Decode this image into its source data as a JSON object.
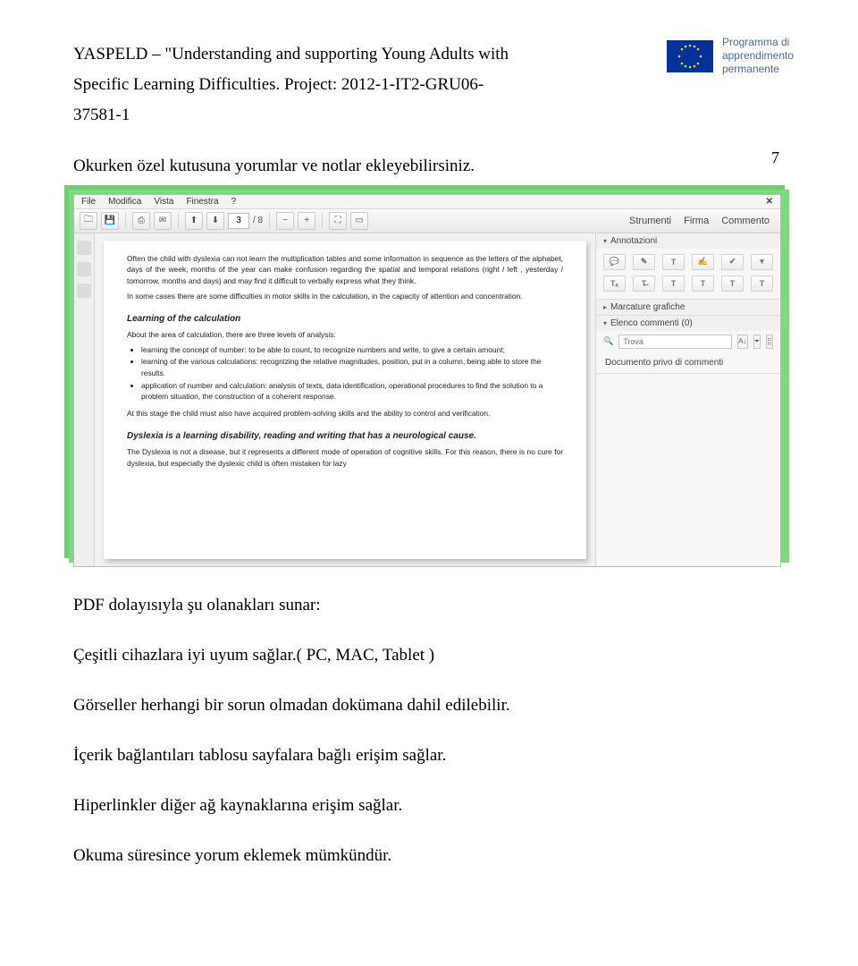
{
  "header": {
    "line1_prefix": "YASPELD – ",
    "line1_quote": "\"Understanding and supporting Young Adults with",
    "line2_quote": "Specific Learning Difficulties.",
    "line2_project": " Project: 2012-1-IT2-GRU06-",
    "line3": "37581-1"
  },
  "logo": {
    "stars": "⁕",
    "programma_line1": "Programma di",
    "programma_line2": "apprendimento",
    "programma_line3": "permanente"
  },
  "page_number": "7",
  "intro_para": "Okurken özel kutusuna yorumlar ve notlar ekleyebilirsiniz.",
  "reader": {
    "menu": {
      "file": "File",
      "modifica": "Modifica",
      "vista": "Vista",
      "finestra": "Finestra",
      "help": "?"
    },
    "toolbar": {
      "page_current": "3",
      "page_total": "/ 8",
      "right": {
        "strumenti": "Strumenti",
        "firma": "Firma",
        "commento": "Commento"
      }
    },
    "doc": {
      "p1": "Often the child with dyslexia can not learn the multiplication tables and some information in sequence as the letters of the alphabet, days of the week, months of the year can make confusion regarding the spatial and temporal relations (right / left , yesterday / tomorrow, months and days) and may find it difficult to verbally express what they think.",
      "p2": "In some cases there are some difficulties in motor skills in the calculation, in the capacity of attention and concentration.",
      "h1": "Learning of the calculation",
      "p3": "About the area of calculation, there are three levels of analysis:",
      "b1": "learning the concept of number: to be able to count, to recognize numbers and write, to give a certain amount;",
      "b2": "learning of the various calculations: recognizing the relative magnitudes, position, put in a column, being able to store the results.",
      "b3": "application of number and calculation: analysis of texts, data identification, operational procedures to find the solution to a problem situation, the construction of a coherent response.",
      "p4": "At this stage the child must also have acquired problem-solving skills and the ability to control and verification.",
      "h2": "Dyslexia is a learning disability, reading and writing that has a neurological cause.",
      "p5": "The Dyslexia is not a disease, but it represents a different mode of operation of cognitive skills. For this reason, there is no cure for dyslexia, but especially the dyslexic child is often mistaken for lazy"
    },
    "panel": {
      "annotazioni": "Annotazioni",
      "marcature": "Marcature grafiche",
      "elenco": "Elenco commenti (0)",
      "trova_label": "Trova",
      "trova_placeholder": "",
      "nocomments": "Documento privo di commenti",
      "glyphs": {
        "a1": "💬",
        "a2": "✎",
        "a3": "T",
        "a4": "✍",
        "a5": "✔",
        "a6": "▾",
        "a7": "Tₐ",
        "a8": "T̶",
        "a9": "T",
        "a10": "T",
        "a11": "T",
        "a12": "T"
      }
    }
  },
  "after": {
    "l1": "PDF dolayısıyla şu olanakları sunar:",
    "l2a": "Çeşitli cihazlara iyi uyum sağlar.( PC, MAC, Tablet )",
    "l3": "Görseller herhangi bir sorun olmadan dokümana dahil edilebilir.",
    "l4": "İçerik bağlantıları tablosu sayfalara bağlı erişim sağlar.",
    "l5": "Hiperlinkler diğer ağ kaynaklarına erişim sağlar.",
    "l6": "Okuma süresince yorum eklemek mümkündür."
  }
}
